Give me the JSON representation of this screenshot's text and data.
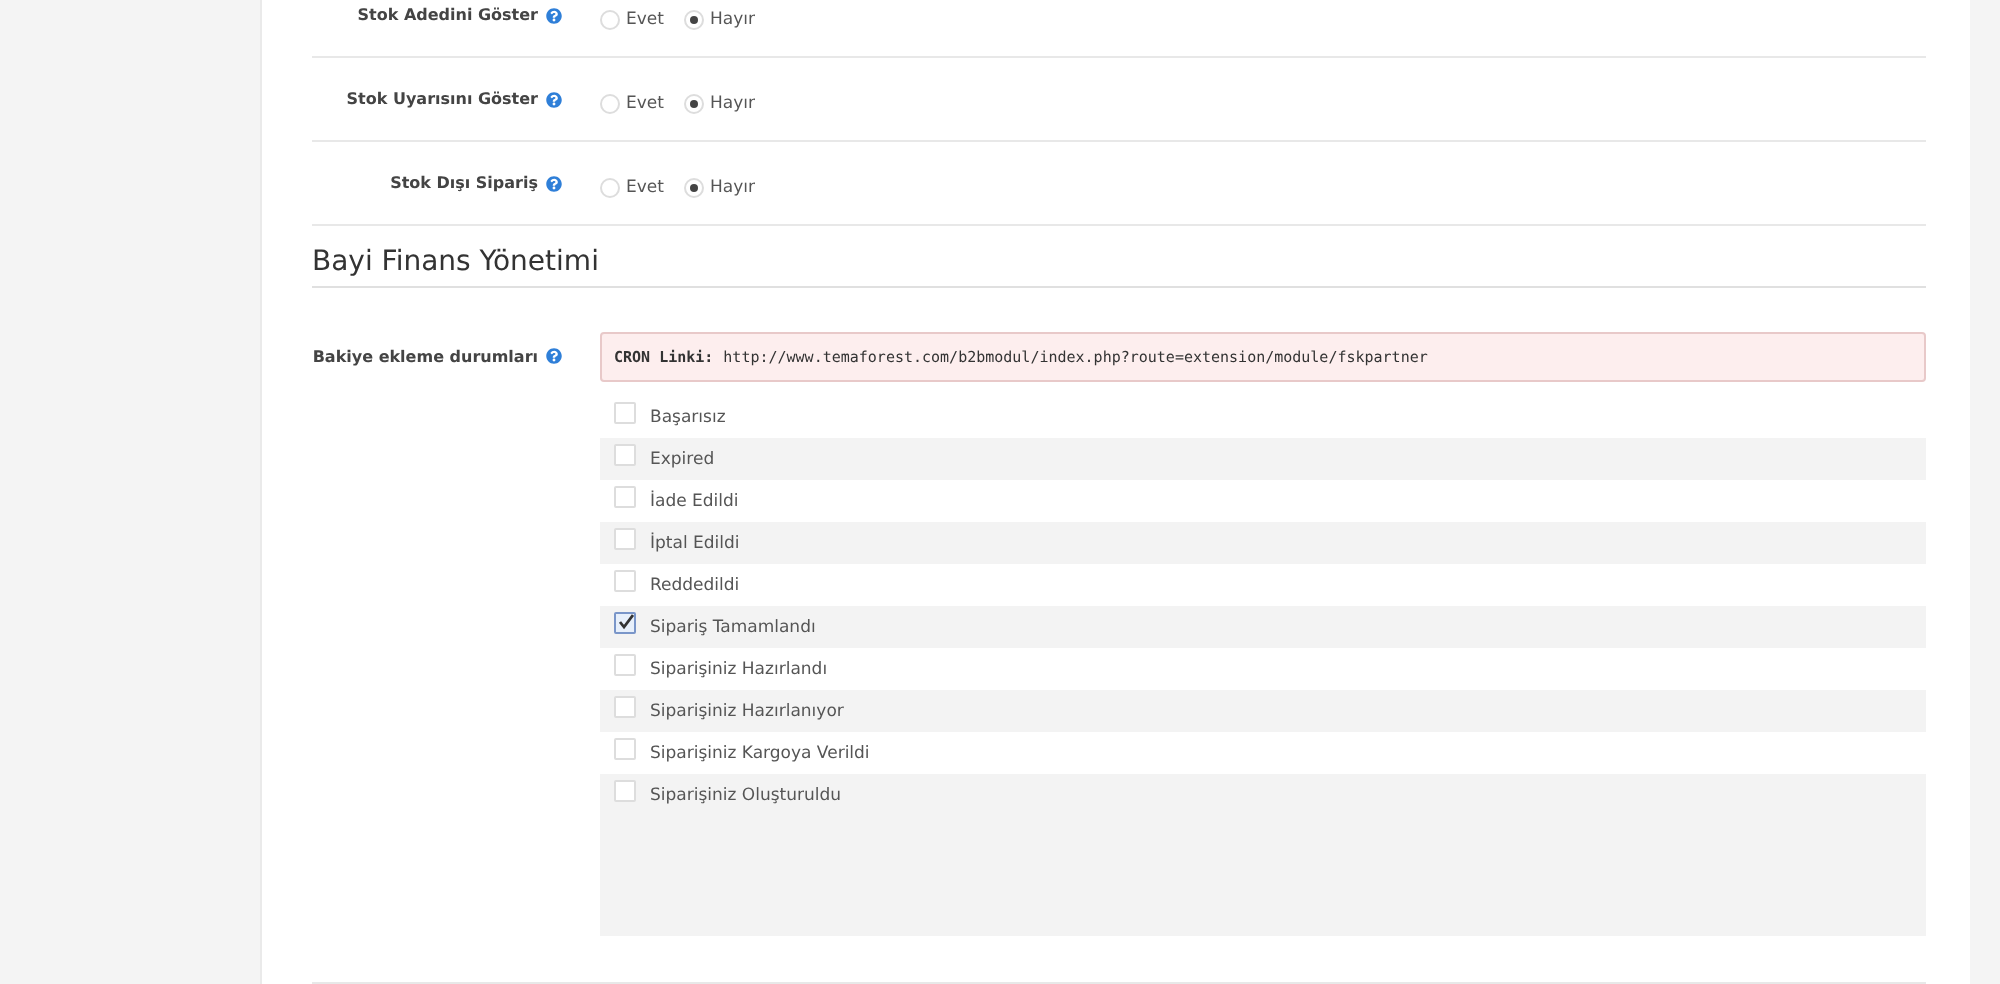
{
  "settings": [
    {
      "label": "Stok Adedini Göster",
      "options": [
        {
          "label": "Evet",
          "selected": false
        },
        {
          "label": "Hayır",
          "selected": true
        }
      ]
    },
    {
      "label": "Stok Uyarısını Göster",
      "options": [
        {
          "label": "Evet",
          "selected": false
        },
        {
          "label": "Hayır",
          "selected": true
        }
      ]
    },
    {
      "label": "Stok Dışı Sipariş",
      "options": [
        {
          "label": "Evet",
          "selected": false
        },
        {
          "label": "Hayır",
          "selected": true
        }
      ]
    }
  ],
  "section": {
    "title": "Bayi Finans Yönetimi",
    "field": {
      "label": "Bakiye ekleme durumları",
      "cron": {
        "label": "CRON Linki:",
        "url": "http://www.temaforest.com/b2bmodul/index.php?route=extension/module/fskpartner"
      },
      "statuses": [
        {
          "label": "Başarısız",
          "checked": false
        },
        {
          "label": "Expired",
          "checked": false
        },
        {
          "label": "İade Edildi",
          "checked": false
        },
        {
          "label": "İptal Edildi",
          "checked": false
        },
        {
          "label": "Reddedildi",
          "checked": false
        },
        {
          "label": "Sipariş Tamamlandı",
          "checked": true
        },
        {
          "label": "Siparişiniz Hazırlandı",
          "checked": false
        },
        {
          "label": "Siparişiniz Hazırlanıyor",
          "checked": false
        },
        {
          "label": "Siparişiniz Kargoya Verildi",
          "checked": false
        },
        {
          "label": "Siparişiniz Oluşturuldu",
          "checked": false
        }
      ]
    }
  }
}
